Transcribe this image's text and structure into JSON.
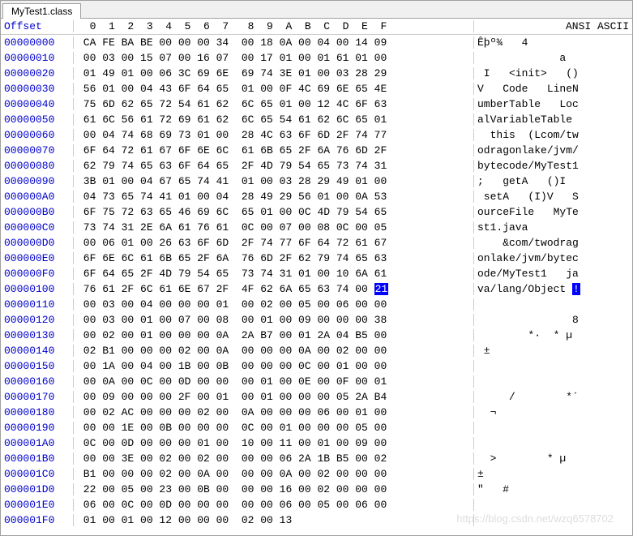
{
  "tab": {
    "label": "MyTest1.class"
  },
  "header": {
    "offset_label": "Offset",
    "cols": [
      "0",
      "1",
      "2",
      "3",
      "4",
      "5",
      "6",
      "7",
      "8",
      "9",
      "A",
      "B",
      "C",
      "D",
      "E",
      "F"
    ],
    "ansi_label": "ANSI ASCII"
  },
  "rows": [
    {
      "off": "00000000",
      "hex": "CA FE BA BE 00 00 00 34  00 18 0A 00 04 00 14 09",
      "ansi": "Êþº¾   4        "
    },
    {
      "off": "00000010",
      "hex": "00 03 00 15 07 00 16 07  00 17 01 00 01 61 01 00",
      "ansi": "             a  "
    },
    {
      "off": "00000020",
      "hex": "01 49 01 00 06 3C 69 6E  69 74 3E 01 00 03 28 29",
      "ansi": " I   <init>   ()"
    },
    {
      "off": "00000030",
      "hex": "56 01 00 04 43 6F 64 65  01 00 0F 4C 69 6E 65 4E",
      "ansi": "V   Code   LineN"
    },
    {
      "off": "00000040",
      "hex": "75 6D 62 65 72 54 61 62  6C 65 01 00 12 4C 6F 63",
      "ansi": "umberTable   Loc"
    },
    {
      "off": "00000050",
      "hex": "61 6C 56 61 72 69 61 62  6C 65 54 61 62 6C 65 01",
      "ansi": "alVariableTable "
    },
    {
      "off": "00000060",
      "hex": "00 04 74 68 69 73 01 00  28 4C 63 6F 6D 2F 74 77",
      "ansi": "  this  (Lcom/tw"
    },
    {
      "off": "00000070",
      "hex": "6F 64 72 61 67 6F 6E 6C  61 6B 65 2F 6A 76 6D 2F",
      "ansi": "odragonlake/jvm/"
    },
    {
      "off": "00000080",
      "hex": "62 79 74 65 63 6F 64 65  2F 4D 79 54 65 73 74 31",
      "ansi": "bytecode/MyTest1"
    },
    {
      "off": "00000090",
      "hex": "3B 01 00 04 67 65 74 41  01 00 03 28 29 49 01 00",
      "ansi": ";   getA   ()I  "
    },
    {
      "off": "000000A0",
      "hex": "04 73 65 74 41 01 00 04  28 49 29 56 01 00 0A 53",
      "ansi": " setA   (I)V   S"
    },
    {
      "off": "000000B0",
      "hex": "6F 75 72 63 65 46 69 6C  65 01 00 0C 4D 79 54 65",
      "ansi": "ourceFile   MyTe"
    },
    {
      "off": "000000C0",
      "hex": "73 74 31 2E 6A 61 76 61  0C 00 07 00 08 0C 00 05",
      "ansi": "st1.java        "
    },
    {
      "off": "000000D0",
      "hex": "00 06 01 00 26 63 6F 6D  2F 74 77 6F 64 72 61 67",
      "ansi": "    &com/twodrag"
    },
    {
      "off": "000000E0",
      "hex": "6F 6E 6C 61 6B 65 2F 6A  76 6D 2F 62 79 74 65 63",
      "ansi": "onlake/jvm/bytec"
    },
    {
      "off": "000000F0",
      "hex": "6F 64 65 2F 4D 79 54 65  73 74 31 01 00 10 6A 61",
      "ansi": "ode/MyTest1   ja"
    },
    {
      "off": "00000100",
      "hex": "76 61 2F 6C 61 6E 67 2F  4F 62 6A 65 63 74 00 21",
      "ansi": "va/lang/Object !",
      "sel_hex": true,
      "sel_ansi": true
    },
    {
      "off": "00000110",
      "hex": "00 03 00 04 00 00 00 01  00 02 00 05 00 06 00 00",
      "ansi": "                "
    },
    {
      "off": "00000120",
      "hex": "00 03 00 01 00 07 00 08  00 01 00 09 00 00 00 38",
      "ansi": "               8"
    },
    {
      "off": "00000130",
      "hex": "00 02 00 01 00 00 00 0A  2A B7 00 01 2A 04 B5 00",
      "ansi": "        *·  * µ "
    },
    {
      "off": "00000140",
      "hex": "02 B1 00 00 00 02 00 0A  00 00 00 0A 00 02 00 00",
      "ansi": " ±              "
    },
    {
      "off": "00000150",
      "hex": "00 1A 00 04 00 1B 00 0B  00 00 00 0C 00 01 00 00",
      "ansi": "                "
    },
    {
      "off": "00000160",
      "hex": "00 0A 00 0C 00 0D 00 00  00 01 00 0E 00 0F 00 01",
      "ansi": "                "
    },
    {
      "off": "00000170",
      "hex": "00 09 00 00 00 2F 00 01  00 01 00 00 00 05 2A B4",
      "ansi": "     /        *´"
    },
    {
      "off": "00000180",
      "hex": "00 02 AC 00 00 00 02 00  0A 00 00 00 06 00 01 00",
      "ansi": "  ¬             "
    },
    {
      "off": "00000190",
      "hex": "00 00 1E 00 0B 00 00 00  0C 00 01 00 00 00 05 00",
      "ansi": "                "
    },
    {
      "off": "000001A0",
      "hex": "0C 00 0D 00 00 00 01 00  10 00 11 00 01 00 09 00",
      "ansi": "                "
    },
    {
      "off": "000001B0",
      "hex": "00 00 3E 00 02 00 02 00  00 00 06 2A 1B B5 00 02",
      "ansi": "  >        * µ  "
    },
    {
      "off": "000001C0",
      "hex": "B1 00 00 00 02 00 0A 00  00 00 0A 00 02 00 00 00",
      "ansi": "±               "
    },
    {
      "off": "000001D0",
      "hex": "22 00 05 00 23 00 0B 00  00 00 16 00 02 00 00 00",
      "ansi": "\"   #           "
    },
    {
      "off": "000001E0",
      "hex": "06 00 0C 00 0D 00 00 00  00 00 06 00 05 00 06 00",
      "ansi": "                "
    },
    {
      "off": "000001F0",
      "hex": "01 00 01 00 12 00 00 00  02 00 13               ",
      "ansi": "                "
    }
  ],
  "watermark": "https://blog.csdn.net/wzq6578702"
}
